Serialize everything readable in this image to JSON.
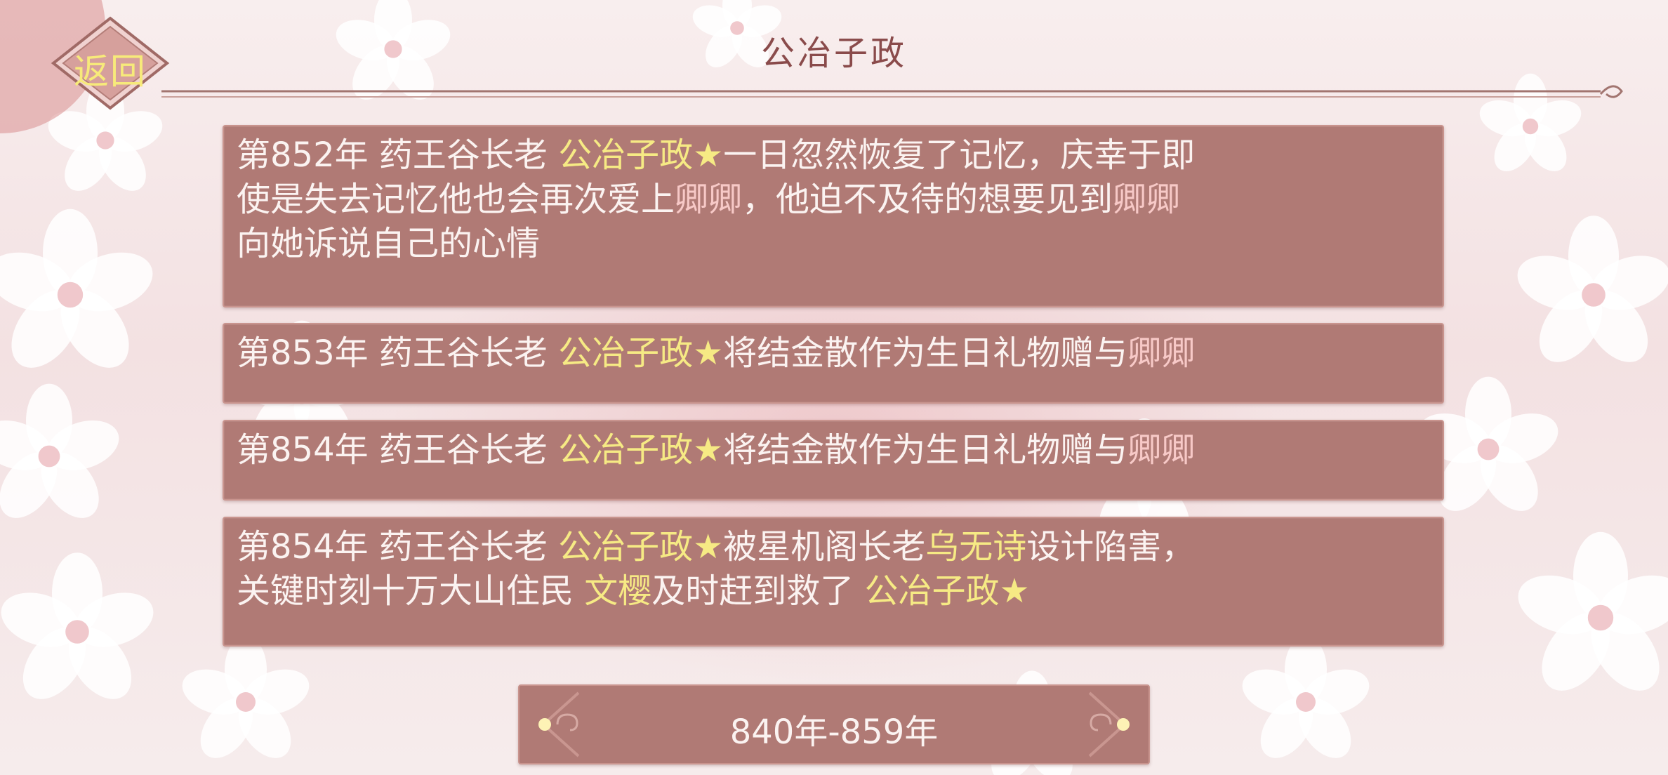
{
  "header": {
    "back_label": "返回",
    "title": "公冶子政"
  },
  "events": [
    {
      "lines": [
        [
          {
            "text": "第852年 药王谷长老 ",
            "style": "plain"
          },
          {
            "text": "公冶子政★",
            "style": "yellow"
          },
          {
            "text": "一日忽然恢复了记忆，庆幸于即",
            "style": "plain"
          }
        ],
        [
          {
            "text": "使是失去记忆他也会再次爱上",
            "style": "plain"
          },
          {
            "text": "卿卿",
            "style": "pink"
          },
          {
            "text": "，他迫不及待的想要见到",
            "style": "plain"
          },
          {
            "text": "卿卿",
            "style": "pink"
          }
        ],
        [
          {
            "text": "向她诉说自己的心情",
            "style": "plain"
          }
        ]
      ]
    },
    {
      "lines": [
        [
          {
            "text": "第853年 药王谷长老 ",
            "style": "plain"
          },
          {
            "text": "公冶子政★",
            "style": "yellow"
          },
          {
            "text": "将结金散作为生日礼物赠与",
            "style": "plain"
          },
          {
            "text": "卿卿",
            "style": "pink"
          }
        ]
      ]
    },
    {
      "lines": [
        [
          {
            "text": "第854年 药王谷长老 ",
            "style": "plain"
          },
          {
            "text": "公冶子政★",
            "style": "yellow"
          },
          {
            "text": "将结金散作为生日礼物赠与",
            "style": "plain"
          },
          {
            "text": "卿卿",
            "style": "pink"
          }
        ]
      ]
    },
    {
      "lines": [
        [
          {
            "text": "第854年 药王谷长老 ",
            "style": "plain"
          },
          {
            "text": "公冶子政★",
            "style": "yellow"
          },
          {
            "text": "被星机阁长老",
            "style": "plain"
          },
          {
            "text": "乌无诗",
            "style": "yellow"
          },
          {
            "text": "设计陷害，",
            "style": "plain"
          }
        ],
        [
          {
            "text": "关键时刻十万大山住民 ",
            "style": "plain"
          },
          {
            "text": "文樱",
            "style": "yellow"
          },
          {
            "text": "及时赶到救了 ",
            "style": "plain"
          },
          {
            "text": "公冶子政★",
            "style": "yellow"
          }
        ]
      ]
    }
  ],
  "footer": {
    "range_label": "840年-859年"
  },
  "colors": {
    "card_bg": "#b07a75",
    "highlight_yellow": "#f6ea84",
    "highlight_pink": "#f7c9c7",
    "title_text": "#8a4b4b"
  },
  "icons": [
    "flower-pattern-icon",
    "back-diamond-frame-icon",
    "cloud-ornament-icon"
  ]
}
